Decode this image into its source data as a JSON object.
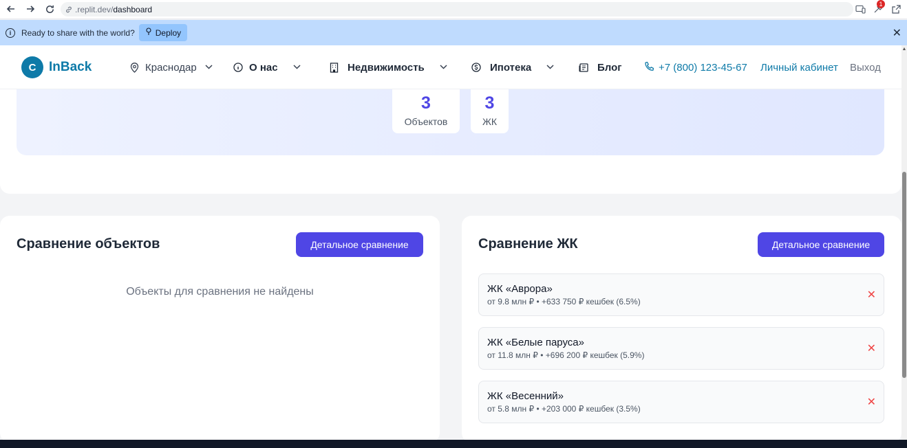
{
  "browser": {
    "url_host": ".replit.dev/",
    "url_path": "dashboard",
    "notification_count": "1"
  },
  "banner": {
    "text": "Ready to share with the world?",
    "deploy_label": "Deploy"
  },
  "header": {
    "logo_letter": "C",
    "logo_text": "InBack",
    "city": "Краснодар",
    "nav": {
      "about": "О нас",
      "realty": "Недвижимость",
      "mortgage": "Ипотека",
      "blog": "Блог"
    },
    "phone": "+7 (800) 123-45-67",
    "cabinet": "Личный кабинет",
    "logout": "Выход"
  },
  "stats": [
    {
      "value": "3",
      "label": "Объектов"
    },
    {
      "value": "3",
      "label": "ЖК"
    }
  ],
  "objects_compare": {
    "title": "Сравнение объектов",
    "button": "Детальное сравнение",
    "empty": "Объекты для сравнения не найдены"
  },
  "complex_compare": {
    "title": "Сравнение ЖК",
    "button": "Детальное сравнение",
    "items": [
      {
        "name": "ЖК «Аврора»",
        "details": "от 9.8 млн ₽ • +633 750 ₽ кешбек (6.5%)"
      },
      {
        "name": "ЖК «Белые паруса»",
        "details": "от 11.8 млн ₽ • +696 200 ₽ кешбек (5.9%)"
      },
      {
        "name": "ЖК «Весенний»",
        "details": "от 5.8 млн ₽ • +203 000 ₽ кешбек (3.5%)"
      }
    ]
  },
  "colors": {
    "brand": "#0e7aa8",
    "accent": "#4f46e5",
    "remove": "#ef4444"
  }
}
